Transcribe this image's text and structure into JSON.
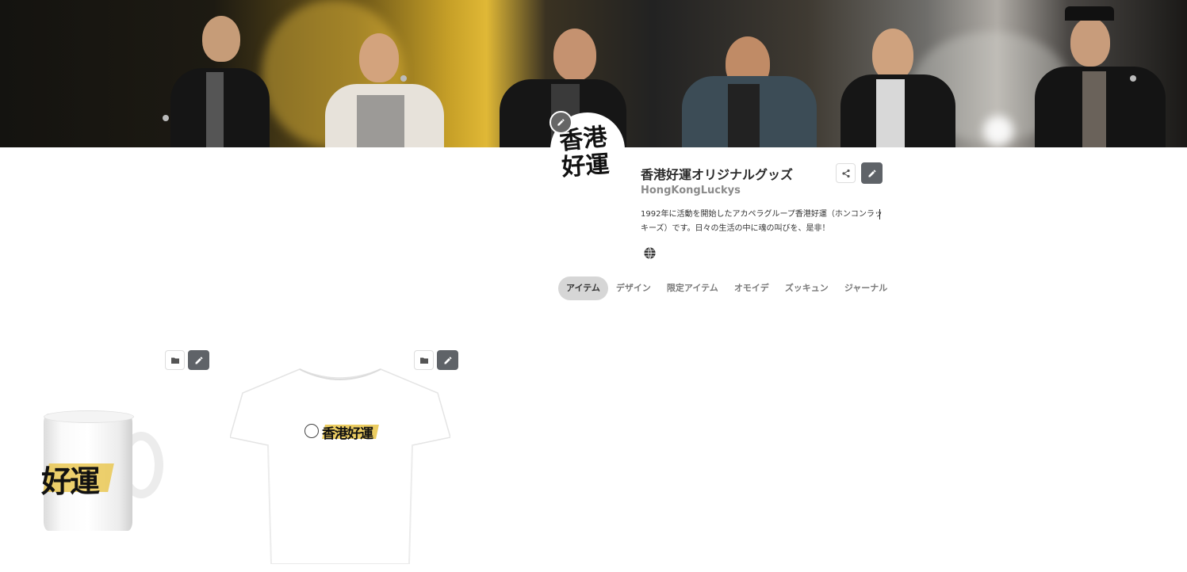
{
  "banner": {
    "alt": "香港好運 live performance photo"
  },
  "profile": {
    "avatar_text": "香港\n好運",
    "title": "香港好運オリジナルグッズ",
    "handle": "HongKongLuckys",
    "description": "1992年に活動を開始したアカペラグループ香港好運（ホンコンラッキーズ）です。日々の生活の中に魂の叫びを、是非！"
  },
  "tabs": [
    {
      "label": "アイテム",
      "active": true
    },
    {
      "label": "デザイン",
      "active": false
    },
    {
      "label": "限定アイテム",
      "active": false
    },
    {
      "label": "オモイデ",
      "active": false
    },
    {
      "label": "ズッキュン",
      "active": false
    },
    {
      "label": "ジャーナル",
      "active": false
    }
  ],
  "products": [
    {
      "type": "mug",
      "print_text": "好運"
    },
    {
      "type": "t-shirt",
      "print_text": "香港好運"
    }
  ],
  "icons": {
    "share": "share-icon",
    "edit": "pencil-icon",
    "folder": "folder-icon",
    "globe": "globe-icon"
  },
  "colors": {
    "dark_button": "#5f6368",
    "active_tab": "#d6d6d6",
    "accent_yellow": "#e6bf3a"
  }
}
